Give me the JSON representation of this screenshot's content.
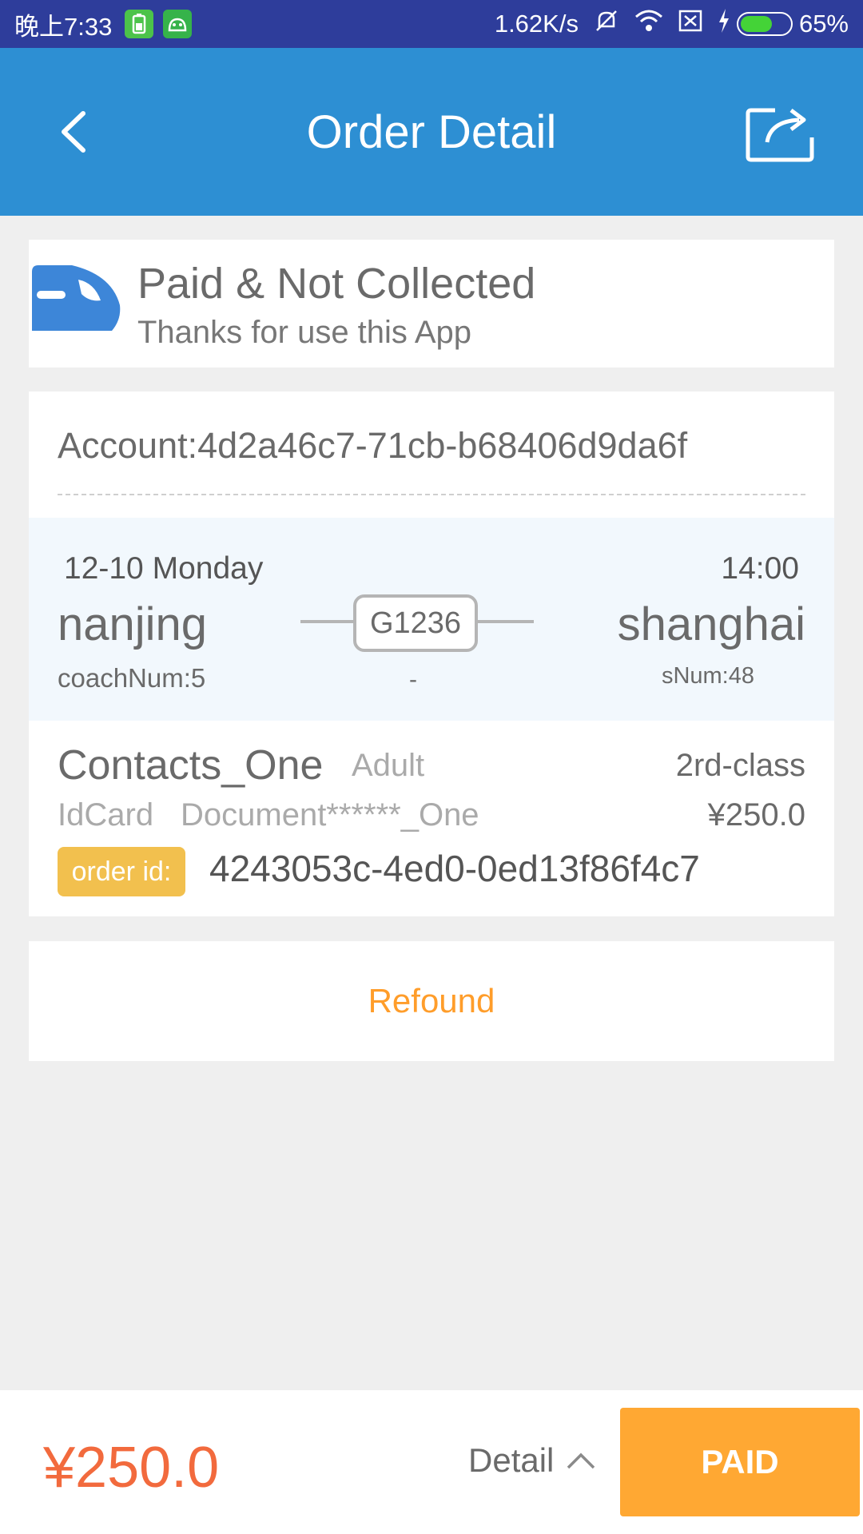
{
  "status_bar": {
    "time": "晚上7:33",
    "network_speed": "1.62K/s",
    "battery_percent": "65%",
    "battery_level": 0.65
  },
  "header": {
    "title": "Order Detail",
    "back_icon": "chevron-left-icon",
    "share_icon": "share-icon"
  },
  "status_card": {
    "title": "Paid & Not Collected",
    "subtitle": "Thanks for use this App",
    "icon": "train-icon",
    "icon_color": "#3d86d8"
  },
  "journey": {
    "account": "Account:4d2a46c7-71cb-b68406d9da6f",
    "date": "12-10 Monday",
    "time": "14:00",
    "from": "nanjing",
    "to": "shanghai",
    "train_no": "G1236",
    "coach": "coachNum:5",
    "seat_num": "sNum:48",
    "duration": "-"
  },
  "passenger": {
    "name": "Contacts_One",
    "type": "Adult",
    "seat_class": "2rd-class",
    "id_label": "IdCard",
    "id_value": "Document******_One",
    "price": "¥250.0",
    "order_label": "order id:",
    "order_id": "4243053c-4ed0-0ed13f86f4c7"
  },
  "actions": {
    "refound": "Refound"
  },
  "bottom": {
    "total": "¥250.0",
    "detail": "Detail",
    "paid": "PAID"
  },
  "colors": {
    "header_bg": "#2d8fd3",
    "status_bar_bg": "#2e3d9b",
    "accent_orange": "#ffa833",
    "price_red": "#f26a3d",
    "badge_yellow": "#f2c04e"
  }
}
